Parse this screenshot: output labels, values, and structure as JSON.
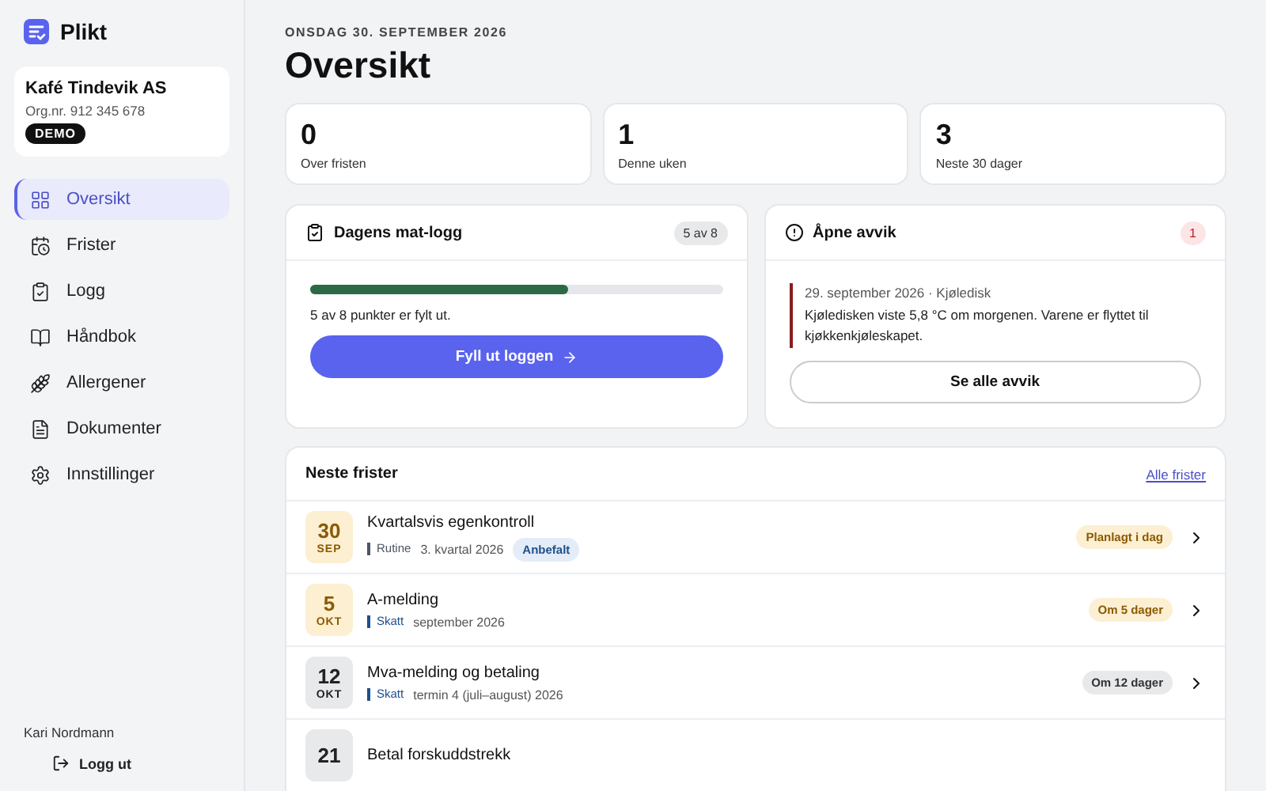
{
  "brand": {
    "name": "Plikt"
  },
  "company": {
    "name": "Kafé Tindevik AS",
    "orgnr": "Org.nr. 912 345 678",
    "badge": "DEMO"
  },
  "nav": [
    {
      "label": "Oversikt",
      "selected": true
    },
    {
      "label": "Frister",
      "selected": false
    },
    {
      "label": "Logg",
      "selected": false
    },
    {
      "label": "Håndbok",
      "selected": false
    },
    {
      "label": "Allergener",
      "selected": false
    },
    {
      "label": "Dokumenter",
      "selected": false
    },
    {
      "label": "Innstillinger",
      "selected": false
    }
  ],
  "user": {
    "name": "Kari Nordmann",
    "logout": "Logg ut"
  },
  "header": {
    "date": "ONSDAG 30. SEPTEMBER 2026",
    "title": "Oversikt"
  },
  "stats": [
    {
      "value": "0",
      "label": "Over fristen"
    },
    {
      "value": "1",
      "label": "Denne uken"
    },
    {
      "value": "3",
      "label": "Neste 30 dager"
    }
  ],
  "food_log": {
    "title": "Dagens mat-logg",
    "count": "5 av 8",
    "level": 0.625,
    "text": "5 av 8 punkter er fylt ut.",
    "button": "Fyll ut loggen"
  },
  "deviations": {
    "title": "Åpne avvik",
    "count": "1",
    "meta": "29. september 2026 · Kjøledisk",
    "text": "Kjøledisken viste 5,8 °C om morgenen. Varene er flyttet til kjøkkenkjøleskapet.",
    "button": "Se alle avvik"
  },
  "deadlines": {
    "title": "Neste frister",
    "link": "Alle frister",
    "rows": [
      {
        "day": "30",
        "month": "SEP",
        "kind": "warm",
        "title": "Kvartalsvis egenkontroll",
        "tag": "Rutine",
        "color": "#4b5563",
        "period": "3. kvartal 2026",
        "extra": "Anbefalt",
        "badge": "Planlagt i dag"
      },
      {
        "day": "5",
        "month": "OKT",
        "kind": "warm",
        "title": "A-melding",
        "tag": "Skatt",
        "color": "#1e4f8c",
        "period": "september 2026",
        "badge": "Om 5 dager"
      },
      {
        "day": "12",
        "month": "OKT",
        "kind": "neutral",
        "title": "Mva-melding og betaling",
        "tag": "Skatt",
        "color": "#1e4f8c",
        "period": "termin 4 (juli–august) 2026",
        "badge": "Om 12 dager"
      },
      {
        "day": "21",
        "kind": "neutral",
        "title": "Betal forskuddstrekk"
      }
    ]
  }
}
